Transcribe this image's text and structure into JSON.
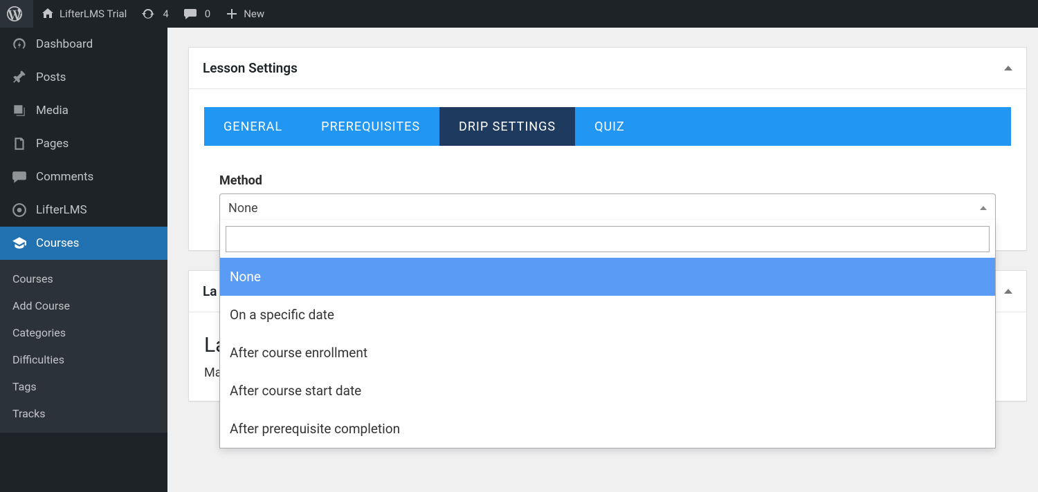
{
  "adminbar": {
    "site_name": "LifterLMS Trial",
    "updates_count": "4",
    "comments_count": "0",
    "new_label": "New"
  },
  "sidebar": {
    "items": [
      {
        "label": "Dashboard"
      },
      {
        "label": "Posts"
      },
      {
        "label": "Media"
      },
      {
        "label": "Pages"
      },
      {
        "label": "Comments"
      },
      {
        "label": "LifterLMS"
      },
      {
        "label": "Courses"
      }
    ],
    "submenu": [
      {
        "label": "Courses"
      },
      {
        "label": "Add Course"
      },
      {
        "label": "Categories"
      },
      {
        "label": "Difficulties"
      },
      {
        "label": "Tags"
      },
      {
        "label": "Tracks"
      }
    ]
  },
  "panel": {
    "title": "Lesson Settings",
    "tabs": [
      {
        "label": "General"
      },
      {
        "label": "Prerequisites"
      },
      {
        "label": "Drip Settings"
      },
      {
        "label": "Quiz"
      }
    ],
    "field_label": "Method",
    "selected_value": "None",
    "search_value": "",
    "options": [
      "None",
      "On a specific date",
      "After course enrollment",
      "After course start date",
      "After prerequisite completion"
    ]
  },
  "panel2": {
    "header_prefix": "La",
    "heading_prefix": "La",
    "sub_prefix": "Ma"
  }
}
